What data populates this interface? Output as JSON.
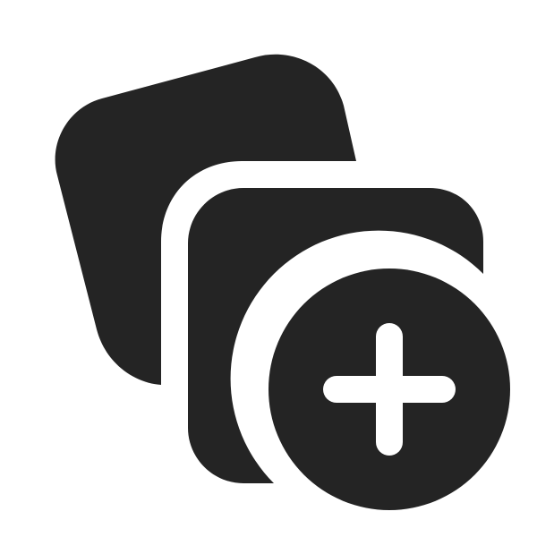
{
  "icon": {
    "name": "add-collection-icon",
    "parts": [
      "back-card-shape",
      "front-card-shape",
      "add-badge-circle",
      "plus-sign"
    ],
    "colors": {
      "shape": "#242424",
      "background": "#ffffff",
      "plus": "#ffffff"
    }
  }
}
